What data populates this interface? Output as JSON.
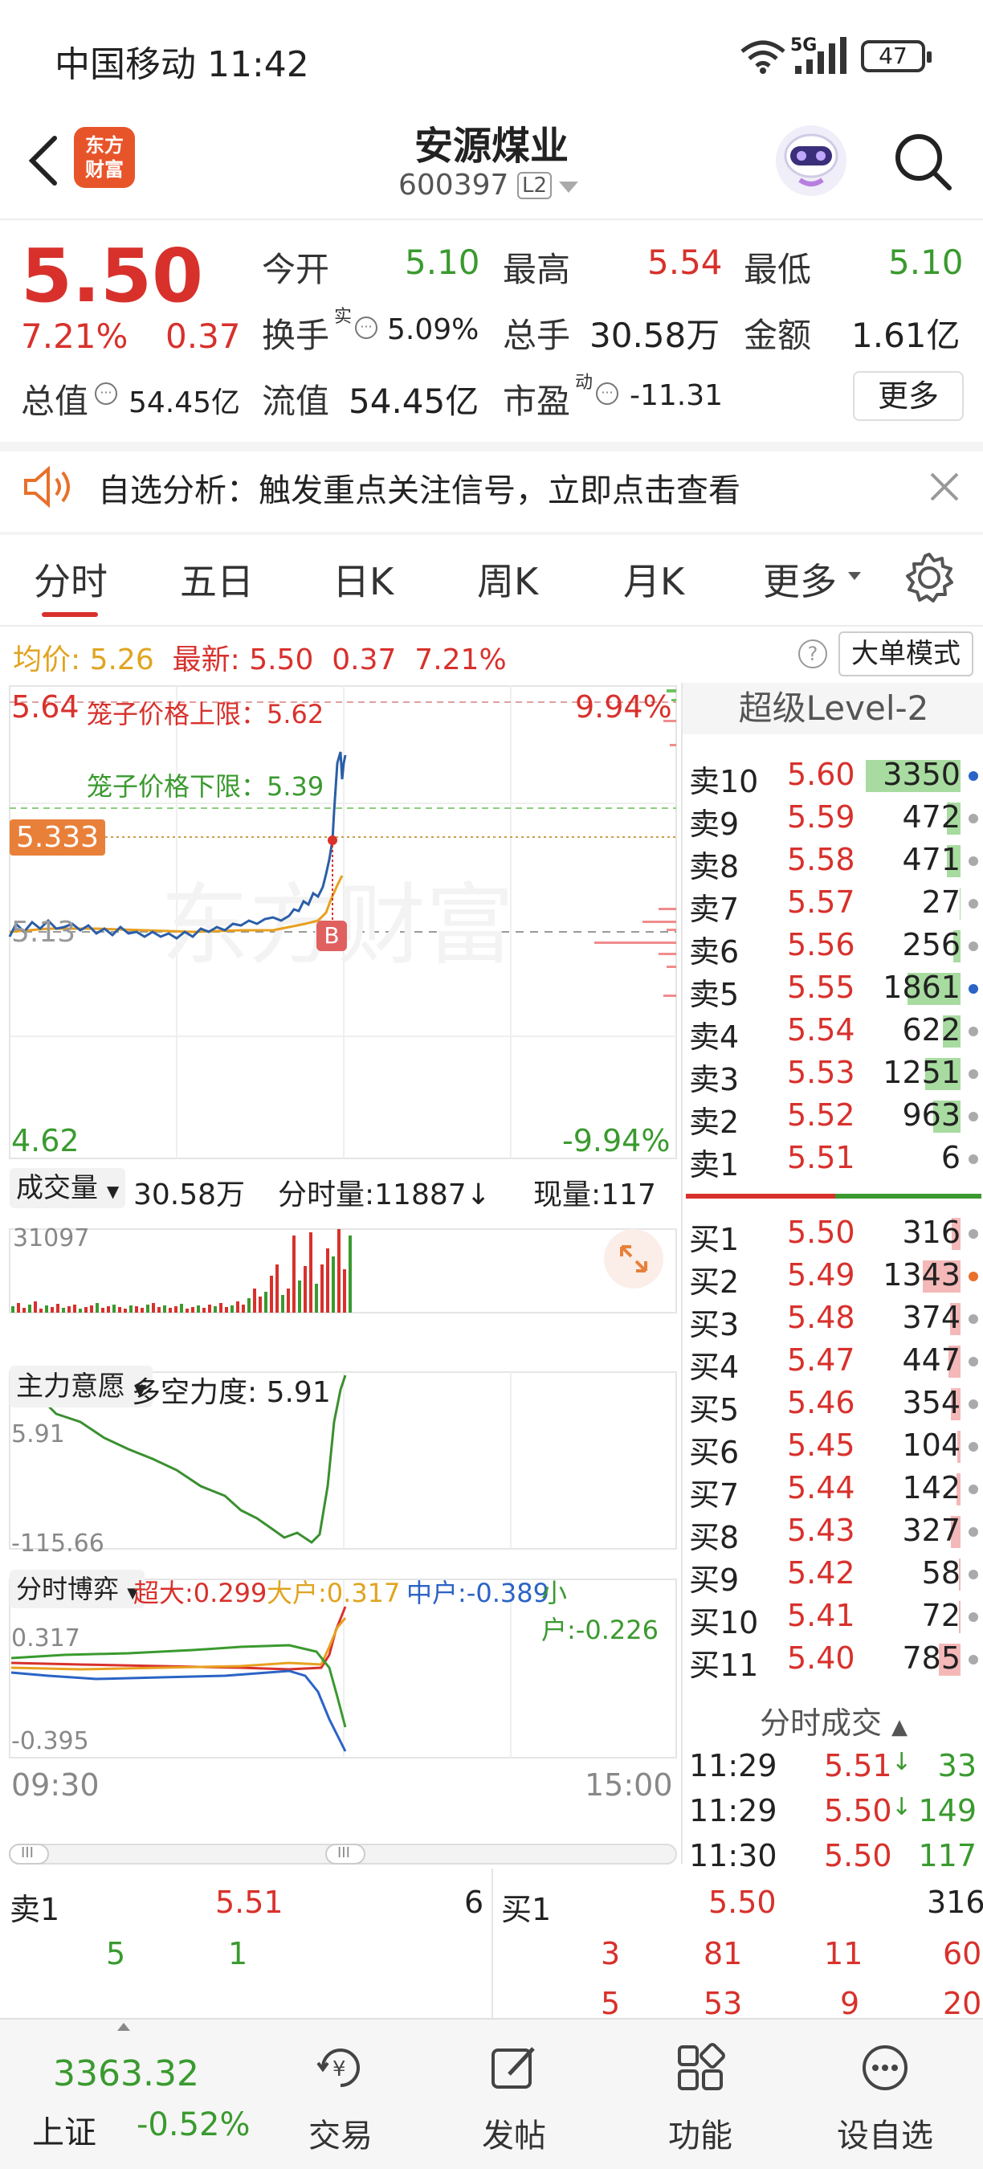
{
  "status_bar": {
    "carrier_time": "中国移动 11:42",
    "network": "5G",
    "battery": "47"
  },
  "header": {
    "logo_line1": "东方",
    "logo_line2": "财富",
    "stock_name": "安源煤业",
    "stock_code": "600397",
    "level_badge": "L2"
  },
  "quote": {
    "price": "5.50",
    "change_pct": "7.21%",
    "change": "0.37",
    "open_label": "今开",
    "open": "5.10",
    "high_label": "最高",
    "high": "5.54",
    "low_label": "最低",
    "low": "5.10",
    "turnover_label": "换手",
    "turnover_sup": "实",
    "turnover": "5.09%",
    "volume_label": "总手",
    "volume": "30.58万",
    "amount_label": "金额",
    "amount": "1.61亿",
    "mktcap_label": "总值",
    "mktcap": "54.45亿",
    "float_label": "流值",
    "float_cap": "54.45亿",
    "pe_label": "市盈",
    "pe_sup": "动",
    "pe": "-11.31",
    "more_label": "更多"
  },
  "notice": {
    "text": "自选分析：触发重点关注信号，立即点击查看"
  },
  "tabs": [
    "分时",
    "五日",
    "日K",
    "周K",
    "月K",
    "更多"
  ],
  "avg_info": {
    "avg_label": "均价: 5.26",
    "latest_label": "最新: 5.50",
    "chg": "0.37",
    "pct": "7.21%",
    "bigorder_label": "大单模式",
    "help": "?"
  },
  "chart": {
    "top_price": "5.64",
    "top_pct": "9.94%",
    "bottom_price": "4.62",
    "bottom_pct": "-9.94%",
    "cage_upper": "笼子价格上限：5.62",
    "cage_lower": "笼子价格下限：5.39",
    "cursor_price": "5.333",
    "base_price": "5.13",
    "b_marker": "B",
    "watermark": "东方财富",
    "vol_label": "成交量",
    "vol_total": "30.58万",
    "vol_tick": "分时量:11887↓",
    "vol_now": "现量:117",
    "vol_max": "31097",
    "main_label": "主力意愿",
    "main_power": "多空力度: 5.91",
    "main_top": "5.91",
    "main_bottom": "-115.66",
    "game_label": "分时博弈",
    "game_super": "超大:0.299",
    "game_big": "大户:0.317",
    "game_mid": "中户:-0.389",
    "game_small": "小户:-0.226",
    "game_top": "0.317",
    "game_bottom": "-0.395",
    "time_start": "09:30",
    "time_end": "15:00",
    "scroll_handle": "III"
  },
  "level2": {
    "title": "超级Level-2",
    "sells": [
      {
        "side": "卖10",
        "price": "5.60",
        "qty": "3350",
        "bar": 1.0,
        "dot": "#2b63c6"
      },
      {
        "side": "卖9",
        "price": "5.59",
        "qty": "472",
        "bar": 0.14,
        "dot": "#aaa"
      },
      {
        "side": "卖8",
        "price": "5.58",
        "qty": "471",
        "bar": 0.14,
        "dot": "#aaa"
      },
      {
        "side": "卖7",
        "price": "5.57",
        "qty": "27",
        "bar": 0.01,
        "dot": "#aaa"
      },
      {
        "side": "卖6",
        "price": "5.56",
        "qty": "256",
        "bar": 0.08,
        "dot": "#aaa"
      },
      {
        "side": "卖5",
        "price": "5.55",
        "qty": "1861",
        "bar": 0.56,
        "dot": "#2b63c6"
      },
      {
        "side": "卖4",
        "price": "5.54",
        "qty": "622",
        "bar": 0.19,
        "dot": "#aaa"
      },
      {
        "side": "卖3",
        "price": "5.53",
        "qty": "1251",
        "bar": 0.37,
        "dot": "#aaa"
      },
      {
        "side": "卖2",
        "price": "5.52",
        "qty": "963",
        "bar": 0.29,
        "dot": "#aaa"
      },
      {
        "side": "卖1",
        "price": "5.51",
        "qty": "6",
        "bar": 0.0,
        "dot": "#aaa"
      }
    ],
    "buys": [
      {
        "side": "买1",
        "price": "5.50",
        "qty": "316",
        "bar": 0.09,
        "dot": "#aaa"
      },
      {
        "side": "买2",
        "price": "5.49",
        "qty": "1343",
        "bar": 0.4,
        "dot": "#e8702a"
      },
      {
        "side": "买3",
        "price": "5.48",
        "qty": "374",
        "bar": 0.11,
        "dot": "#aaa"
      },
      {
        "side": "买4",
        "price": "5.47",
        "qty": "447",
        "bar": 0.13,
        "dot": "#aaa"
      },
      {
        "side": "买5",
        "price": "5.46",
        "qty": "354",
        "bar": 0.1,
        "dot": "#aaa"
      },
      {
        "side": "买6",
        "price": "5.45",
        "qty": "104",
        "bar": 0.03,
        "dot": "#aaa"
      },
      {
        "side": "买7",
        "price": "5.44",
        "qty": "142",
        "bar": 0.04,
        "dot": "#aaa"
      },
      {
        "side": "买8",
        "price": "5.43",
        "qty": "327",
        "bar": 0.1,
        "dot": "#aaa"
      },
      {
        "side": "买9",
        "price": "5.42",
        "qty": "58",
        "bar": 0.02,
        "dot": "#aaa"
      },
      {
        "side": "买10",
        "price": "5.41",
        "qty": "72",
        "bar": 0.02,
        "dot": "#aaa"
      },
      {
        "side": "买11",
        "price": "5.40",
        "qty": "785",
        "bar": 0.23,
        "dot": "#aaa"
      }
    ],
    "trades_title": "分时成交",
    "trades": [
      {
        "time": "11:29",
        "price": "5.51",
        "arrow": "↓",
        "qty": "33"
      },
      {
        "time": "11:29",
        "price": "5.50",
        "arrow": "↓",
        "qty": "149"
      },
      {
        "time": "11:30",
        "price": "5.50",
        "arrow": "",
        "qty": "117"
      }
    ]
  },
  "deals": {
    "sell_label": "卖1",
    "sell_price": "5.51",
    "sell_qty": "6",
    "sell_row2": [
      "5",
      "1"
    ],
    "buy_label": "买1",
    "buy_price": "5.50",
    "buy_qty": "316",
    "buy_row2": [
      "3",
      "81",
      "11",
      "60"
    ],
    "buy_row3": [
      "5",
      "53",
      "9",
      "20"
    ]
  },
  "bottom_nav": {
    "index_value": "3363.32",
    "index_name": "上证",
    "index_pct": "-0.52%",
    "items": [
      "交易",
      "发帖",
      "功能",
      "设自选"
    ]
  }
}
